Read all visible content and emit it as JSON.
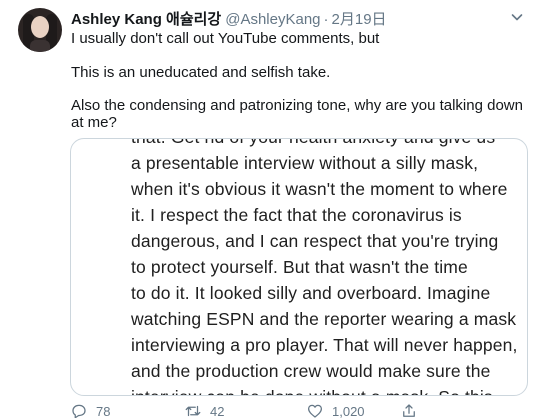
{
  "tweet": {
    "author_name": "Ashley Kang 애슐리강",
    "handle": "@AshleyKang",
    "separator": "·",
    "date": "2月19日",
    "lines": [
      "I usually don't call out YouTube comments, but",
      "This is an uneducated and selfish take.",
      "Also the condensing and patronizing tone, why are you talking down at me?"
    ]
  },
  "media": {
    "lines": [
      "that. Get rid of your health anxiety and give us",
      "a presentable interview without a silly mask,",
      "when it's obvious it wasn't the moment to where",
      "it. I respect the fact that the coronavirus is",
      "dangerous, and I can respect that you're trying",
      "to protect yourself. But that wasn't the time",
      "to do it. It looked silly and overboard. Imagine",
      "watching ESPN and the reporter wearing a mask",
      "interviewing a pro player. That will never happen,",
      "and the production crew would make sure the",
      "interview can be done without a mask. So this"
    ]
  },
  "actions": {
    "reply_count": "78",
    "retweet_count": "42",
    "like_count": "1,020"
  },
  "icons": {
    "reply": "reply-icon",
    "retweet": "retweet-icon",
    "like": "heart-icon",
    "share": "share-icon",
    "menu": "chevron-down-icon"
  },
  "colors": {
    "text": "#14171a",
    "secondary": "#657786",
    "border": "#ccd6dd"
  }
}
